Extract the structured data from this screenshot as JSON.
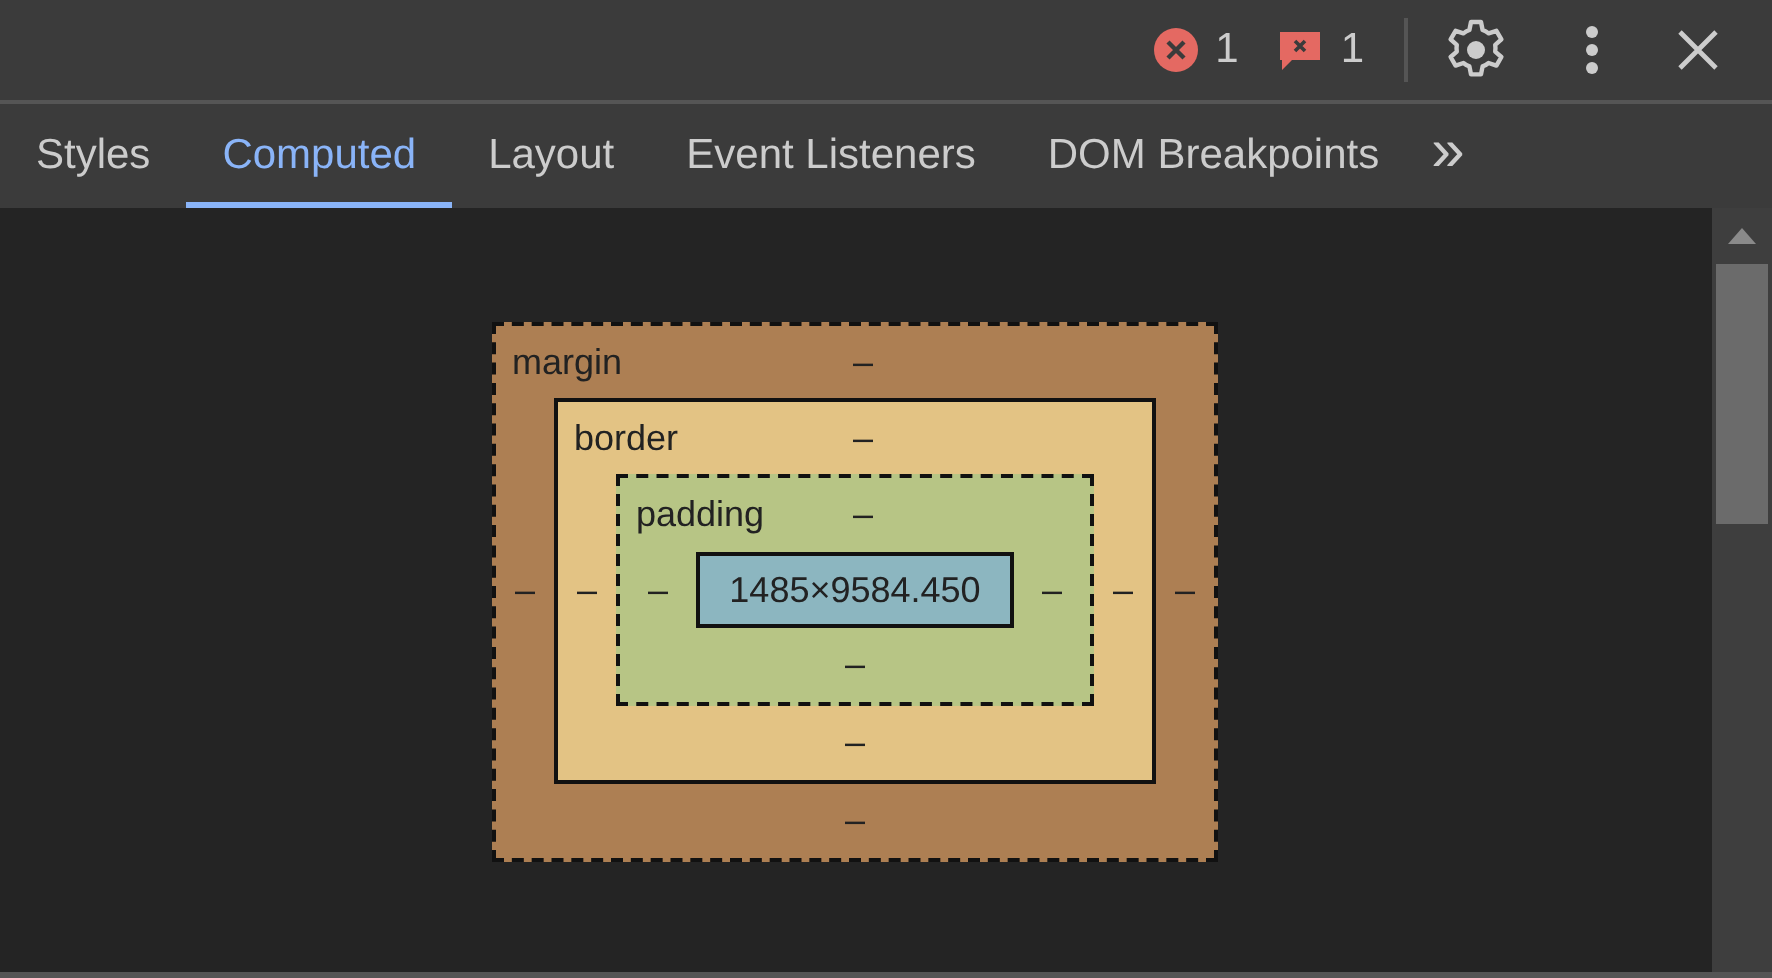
{
  "toolbar": {
    "errors": "1",
    "issues": "1"
  },
  "tabs": [
    {
      "label": "Styles",
      "selected": false
    },
    {
      "label": "Computed",
      "selected": true
    },
    {
      "label": "Layout",
      "selected": false
    },
    {
      "label": "Event Listeners",
      "selected": false
    },
    {
      "label": "DOM Breakpoints",
      "selected": false
    }
  ],
  "more_tabs": "»",
  "box_model": {
    "label": "margin",
    "kind": "dashed",
    "top": "–",
    "left": "–",
    "inner": {
      "label": "border",
      "kind": "solid",
      "top": "–",
      "left": "–",
      "inner": {
        "label": "padding",
        "kind": "dashed",
        "top": "–",
        "left": "–",
        "content": "1485×9584.450",
        "right": "–",
        "bottom": "–"
      },
      "right": "–",
      "bottom": "–"
    },
    "right": "–",
    "bottom": "–"
  }
}
